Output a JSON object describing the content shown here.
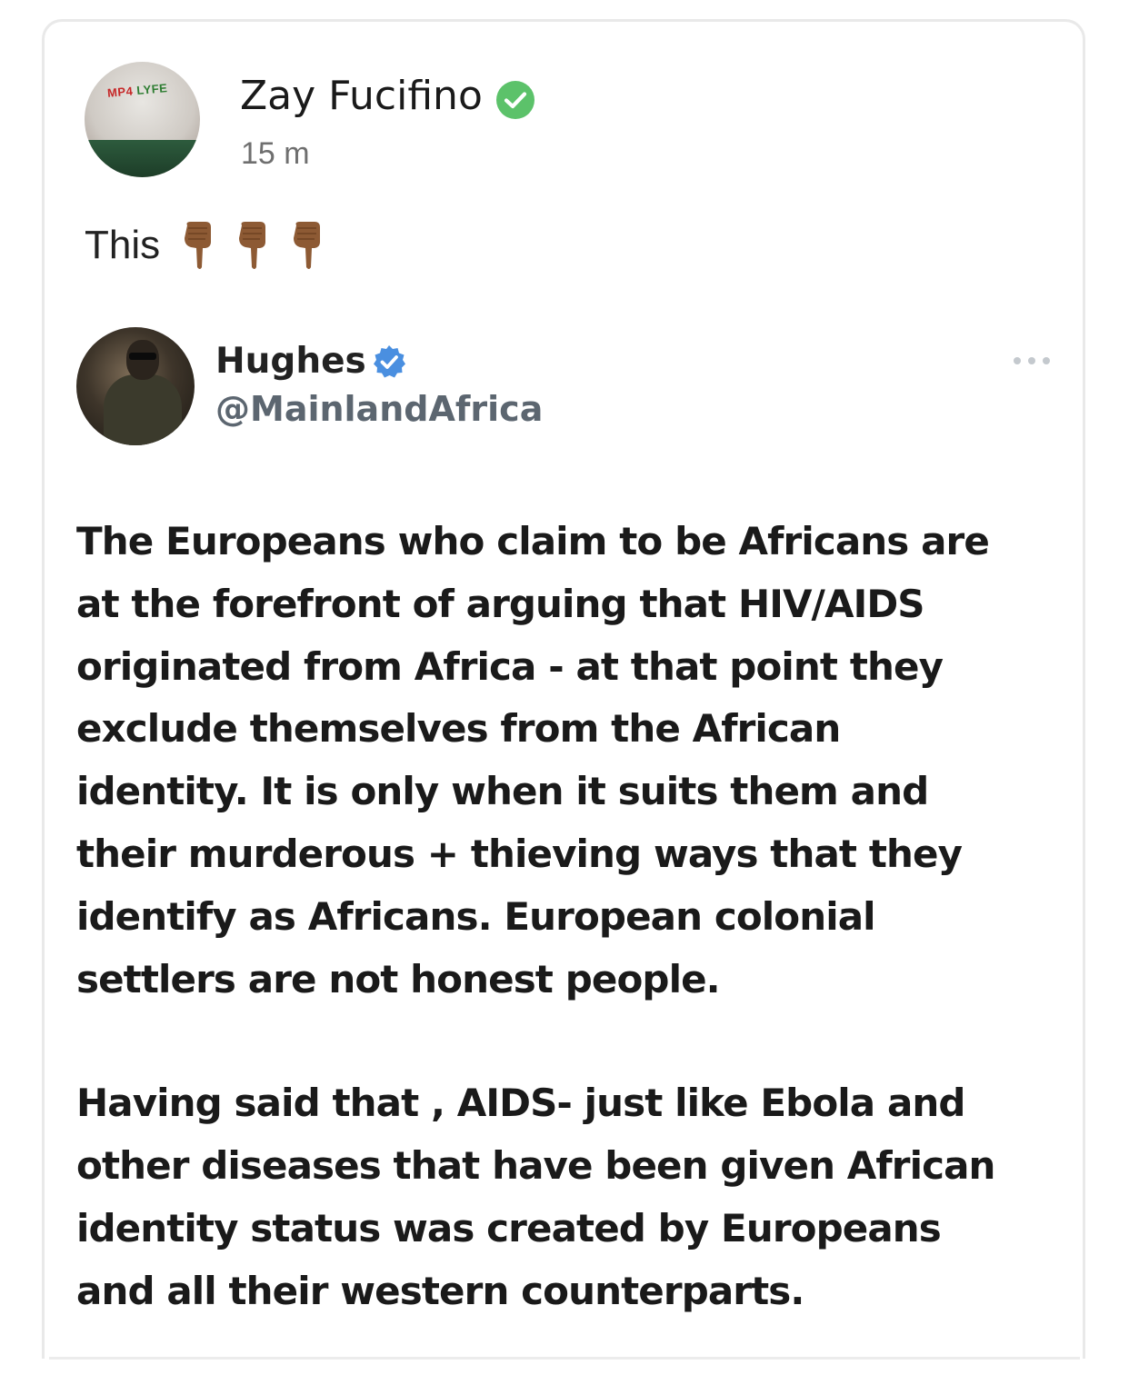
{
  "post": {
    "author": {
      "name": "Zay Fucifino",
      "verified_color": "#5cc26a",
      "avatar_text_1": "MP4",
      "avatar_text_2": "LYFE"
    },
    "time": "15 m",
    "text": "This",
    "emoji": [
      "backhand-index-pointing-down",
      "backhand-index-pointing-down",
      "backhand-index-pointing-down"
    ]
  },
  "quoted": {
    "name": "Hughes",
    "handle": "@MainlandAfrica",
    "verified_color": "#4a8fe0",
    "paragraphs": [
      "The  Europeans who claim to be Africans are\nat the forefront of arguing that HIV/AIDS\noriginated from Africa - at that point they\nexclude themselves from the African\nidentity. It is only when it suits them and\ntheir murderous + thieving ways that they\nidentify as Africans. European colonial\nsettlers are not honest people.",
      "Having said that , AIDS- just like Ebola and\nother diseases that have been given African\nidentity status was created by Europeans\nand all their western counterparts."
    ]
  },
  "colors": {
    "text_primary": "#1a1a1a",
    "text_secondary": "#6f6f6f",
    "handle": "#5c6670",
    "card_border": "#e9e9e9"
  }
}
